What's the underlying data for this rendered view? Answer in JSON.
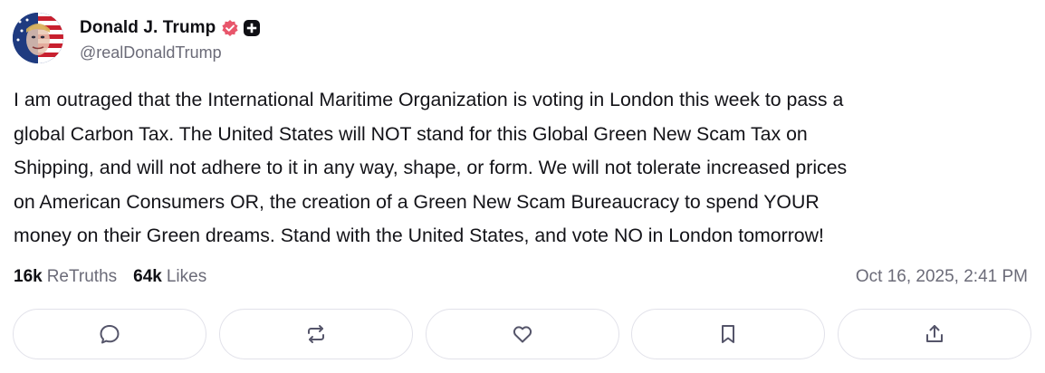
{
  "author": {
    "name": "Donald J. Trump",
    "handle": "@realDonaldTrump",
    "avatar_icon": "flag-portrait-avatar",
    "verified_icon": "verified-badge-icon",
    "verified_color": "#e8566b",
    "plus_icon": "plus-badge-icon"
  },
  "post": {
    "lines": [
      "I am outraged that the International Maritime Organization is voting in London this week to pass a",
      "global Carbon Tax. The United States will NOT stand for this Global Green New Scam Tax on",
      "Shipping, and will not adhere to it in any way, shape, or form. We will not tolerate increased prices",
      "on American Consumers OR, the creation of a Green New Scam Bureaucracy to spend YOUR",
      "money on their Green dreams. Stand with the United States, and vote NO in London tomorrow!"
    ]
  },
  "stats": {
    "retruths_count": "16k",
    "retruths_label": "ReTruths",
    "likes_count": "64k",
    "likes_label": "Likes"
  },
  "timestamp": "Oct 16, 2025, 2:41 PM",
  "actions": [
    {
      "icon": "reply-icon"
    },
    {
      "icon": "retruth-icon"
    },
    {
      "icon": "like-icon"
    },
    {
      "icon": "bookmark-icon"
    },
    {
      "icon": "share-icon"
    }
  ],
  "colors": {
    "text": "#131318",
    "muted": "#6b6b78",
    "border": "#e2e2ea",
    "icon": "#55556a"
  }
}
